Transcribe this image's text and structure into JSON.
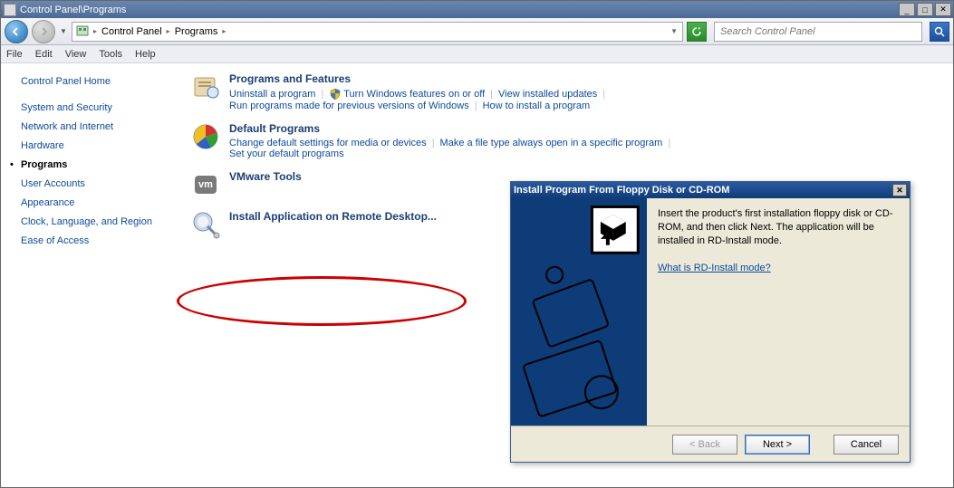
{
  "window": {
    "title": "Control Panel\\Programs",
    "min": "_",
    "max": "□",
    "close": "✕"
  },
  "nav": {
    "crumb1": "Control Panel",
    "crumb2": "Programs",
    "search_placeholder": "Search Control Panel"
  },
  "menubar": [
    "File",
    "Edit",
    "View",
    "Tools",
    "Help"
  ],
  "sidebar": {
    "items": [
      {
        "label": "Control Panel Home",
        "current": false
      },
      {
        "label": "System and Security",
        "current": false
      },
      {
        "label": "Network and Internet",
        "current": false
      },
      {
        "label": "Hardware",
        "current": false
      },
      {
        "label": "Programs",
        "current": true
      },
      {
        "label": "User Accounts",
        "current": false
      },
      {
        "label": "Appearance",
        "current": false
      },
      {
        "label": "Clock, Language, and Region",
        "current": false
      },
      {
        "label": "Ease of Access",
        "current": false
      }
    ]
  },
  "sections": {
    "programs": {
      "title": "Programs and Features",
      "links": {
        "uninstall": "Uninstall a program",
        "turn_features": "Turn Windows features on or off",
        "view_updates": "View installed updates",
        "run_prev": "Run programs made for previous versions of Windows",
        "how_install": "How to install a program"
      }
    },
    "default": {
      "title": "Default Programs",
      "links": {
        "change": "Change default settings for media or devices",
        "filetype": "Make a file type always open in a specific program",
        "set": "Set your default programs"
      }
    },
    "vmware": {
      "title": "VMware Tools"
    },
    "remote": {
      "title": "Install Application on Remote Desktop..."
    }
  },
  "dialog": {
    "title": "Install Program From Floppy Disk or CD-ROM",
    "body": "Insert the product's first installation floppy disk or CD-ROM, and then click Next. The application will be installed in RD-Install mode.",
    "link": "What is RD-Install mode?",
    "back": "< Back",
    "next": "Next >",
    "cancel": "Cancel"
  }
}
